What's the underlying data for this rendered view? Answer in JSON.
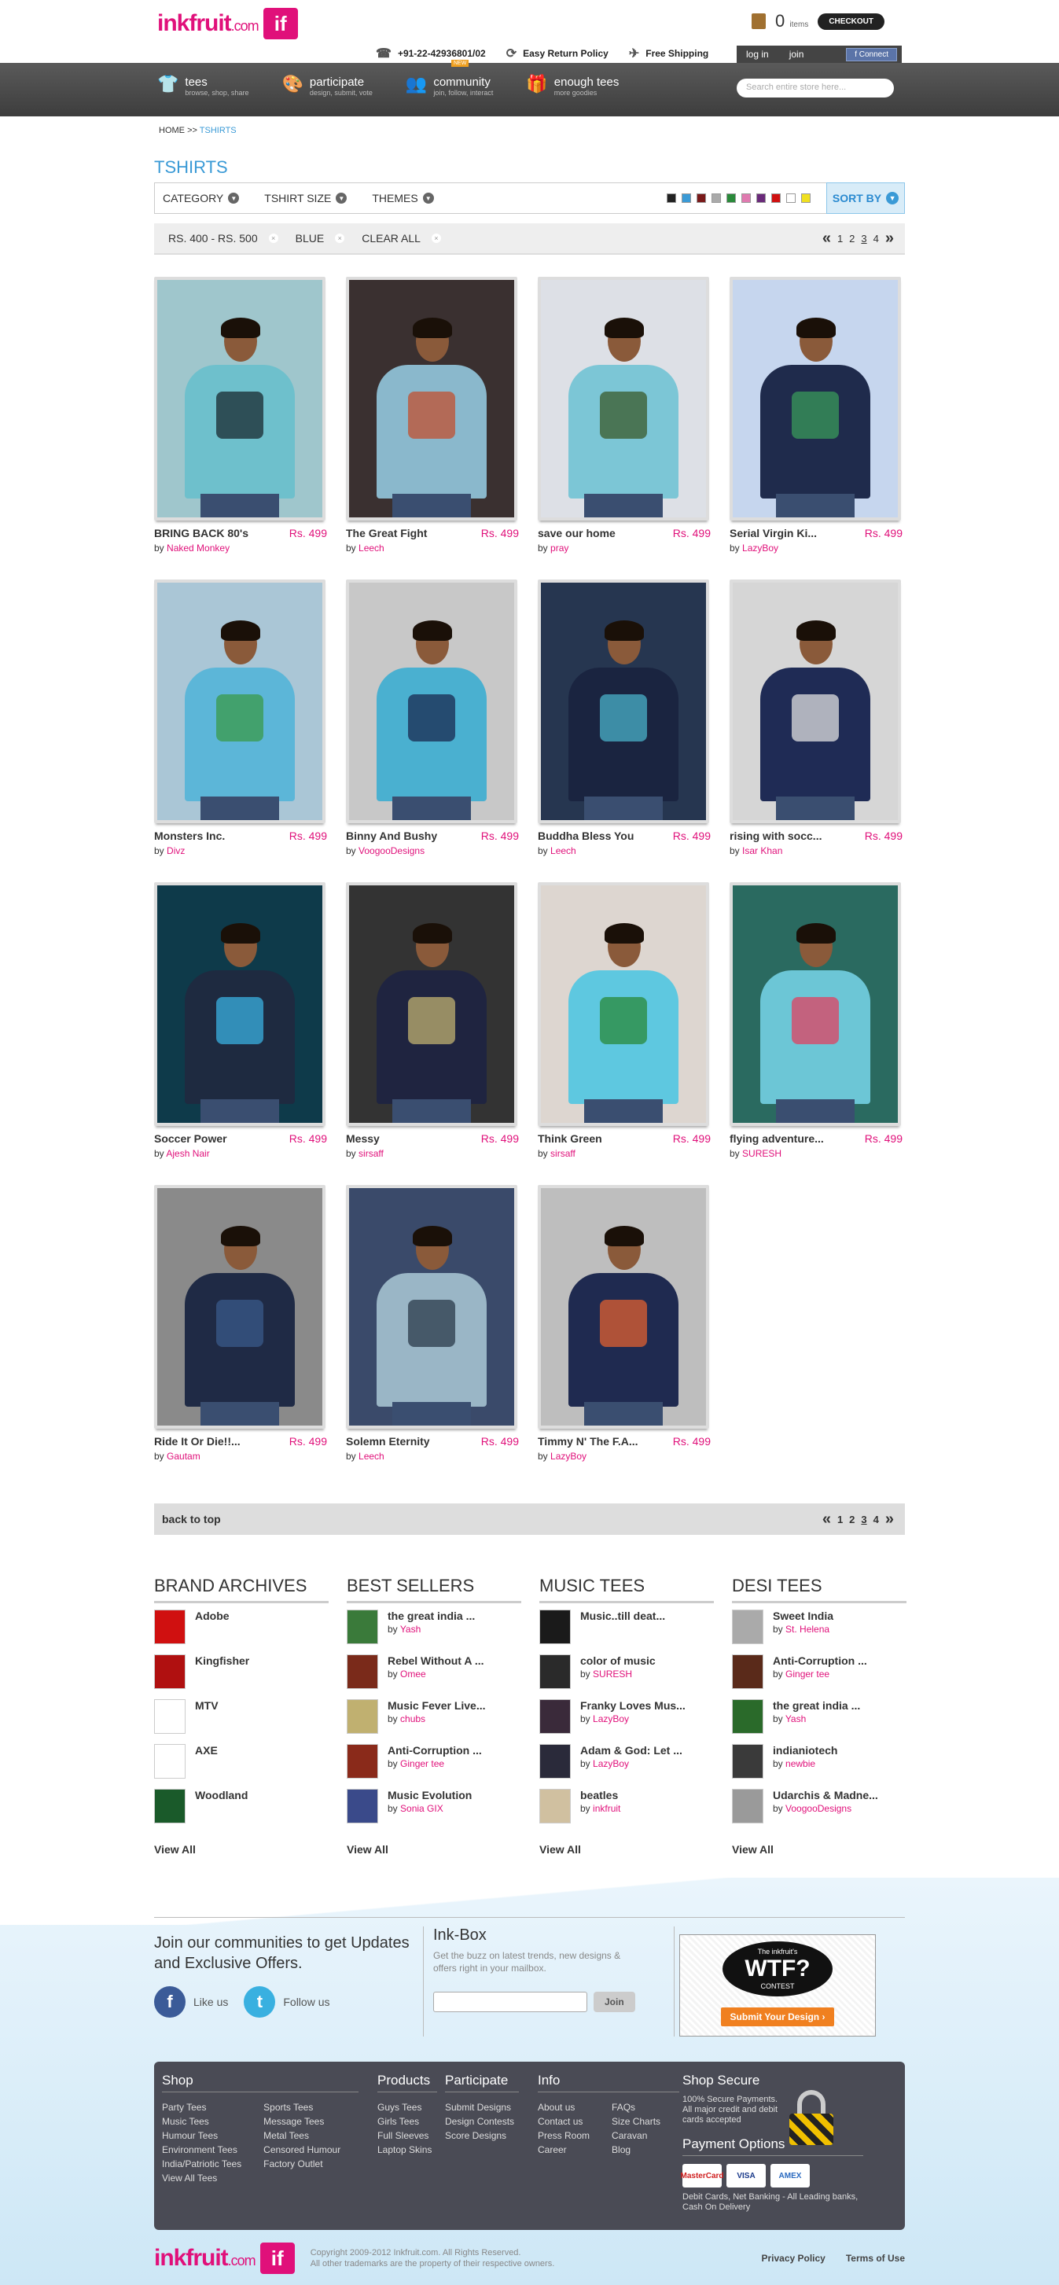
{
  "header": {
    "logo_text": "inkfruit",
    "logo_suffix": ".com",
    "logo_mark": "if",
    "phone": "+91-22-42936801/02",
    "returns": "Easy Return Policy",
    "shipping": "Free Shipping",
    "cart_count": "0",
    "cart_label": "items",
    "checkout_label": "CHECKOUT",
    "login_label": "log in",
    "join_label": "join",
    "fb_connect_label": "Connect"
  },
  "nav": {
    "items": [
      {
        "title": "tees",
        "subtitle": "browse, shop, share",
        "icon": "tshirt-icon"
      },
      {
        "title": "participate",
        "subtitle": "design, submit, vote",
        "icon": "palette-icon"
      },
      {
        "title": "community",
        "subtitle": "join, follow, interact",
        "icon": "people-icon"
      },
      {
        "title": "enough tees",
        "subtitle": "more goodies",
        "icon": "gift-icon"
      }
    ],
    "new_tag": "NEW",
    "search_placeholder": "Search entire store here..."
  },
  "breadcrumb": {
    "home": "HOME",
    "sep": ">>",
    "current": "TSHIRTS"
  },
  "page_title": "TSHIRTS",
  "filters": {
    "category": "CATEGORY",
    "size": "TSHIRT SIZE",
    "themes": "THEMES",
    "swatches": [
      "#222222",
      "#3a9ad6",
      "#7a1a1a",
      "#aaaaaa",
      "#2a8a3a",
      "#e07ab0",
      "#6a2a7a",
      "#d01010",
      "#ffffff",
      "#f0e020"
    ],
    "sort_label": "SORT BY"
  },
  "active_filters": {
    "chips": [
      "RS. 400 - RS. 500",
      "BLUE",
      "CLEAR ALL"
    ],
    "pages": [
      "1",
      "2",
      "3",
      "4"
    ]
  },
  "products": [
    {
      "name": "BRING BACK 80's",
      "price": "Rs. 499",
      "by": "by",
      "artist": "Naked Monkey",
      "bg": "#9fc6cc",
      "tee": "#6ec0cc",
      "art": "#1a2a30"
    },
    {
      "name": "The Great Fight",
      "price": "Rs. 499",
      "by": "by",
      "artist": "Leech",
      "bg": "#3a3030",
      "tee": "#8ab8cc",
      "art": "#c05030"
    },
    {
      "name": "save our home",
      "price": "Rs. 499",
      "by": "by",
      "artist": "pray",
      "bg": "#dde0e6",
      "tee": "#7cc6d6",
      "art": "#3a5a2a"
    },
    {
      "name": "Serial Virgin Ki...",
      "price": "Rs. 499",
      "by": "by",
      "artist": "LazyBoy",
      "bg": "#c6d6ee",
      "tee": "#1f2b4c",
      "art": "#3a9a5a"
    },
    {
      "name": "Monsters Inc.",
      "price": "Rs. 499",
      "by": "by",
      "artist": "Divz",
      "bg": "#aac6d6",
      "tee": "#5cb6d8",
      "art": "#3a9a4a"
    },
    {
      "name": "Binny And Bushy",
      "price": "Rs. 499",
      "by": "by",
      "artist": "VoogooDesigns",
      "bg": "#c8c8c8",
      "tee": "#4ab0d0",
      "art": "#1a2a50"
    },
    {
      "name": "Buddha Bless You",
      "price": "Rs. 499",
      "by": "by",
      "artist": "Leech",
      "bg": "#263650",
      "tee": "#1a2440",
      "art": "#4ab0c8"
    },
    {
      "name": "rising with socc...",
      "price": "Rs. 499",
      "by": "by",
      "artist": "Isar Khan",
      "bg": "#d6d6d6",
      "tee": "#1f2b55",
      "art": "#e0e0e0"
    },
    {
      "name": "Soccer Power",
      "price": "Rs. 499",
      "by": "by",
      "artist": "Ajesh Nair",
      "bg": "#0e3a4a",
      "tee": "#1e2a40",
      "art": "#3ab0e0"
    },
    {
      "name": "Messy",
      "price": "Rs. 499",
      "by": "by",
      "artist": "sirsaff",
      "bg": "#333333",
      "tee": "#1f2440",
      "art": "#c0b070"
    },
    {
      "name": "Think Green",
      "price": "Rs. 499",
      "by": "by",
      "artist": "sirsaff",
      "bg": "#ddd6d0",
      "tee": "#5ec8e0",
      "art": "#2a8a3a"
    },
    {
      "name": "flying adventure...",
      "price": "Rs. 499",
      "by": "by",
      "artist": "SURESH",
      "bg": "#2a6a60",
      "tee": "#6cc6d6",
      "art": "#e04060"
    },
    {
      "name": "Ride It Or Die!!...",
      "price": "Rs. 499",
      "by": "by",
      "artist": "Gautam",
      "bg": "#8a8a8a",
      "tee": "#1f2a45",
      "art": "#3a5a8a"
    },
    {
      "name": "Solemn Eternity",
      "price": "Rs. 499",
      "by": "by",
      "artist": "Leech",
      "bg": "#3a4a6a",
      "tee": "#9ab6c6",
      "art": "#2a3a4a"
    },
    {
      "name": "Timmy N' The F.A...",
      "price": "Rs. 499",
      "by": "by",
      "artist": "LazyBoy",
      "bg": "#bebebe",
      "tee": "#1f2a50",
      "art": "#e06030"
    }
  ],
  "back_to_top": "back to top",
  "lists": [
    {
      "heading": "BRAND ARCHIVES",
      "items": [
        {
          "title": "Adobe",
          "by": "",
          "artist": "",
          "thumb": "#d01010"
        },
        {
          "title": "Kingfisher",
          "by": "",
          "artist": "",
          "thumb": "#b01010"
        },
        {
          "title": "MTV",
          "by": "",
          "artist": "",
          "thumb": "#ffffff"
        },
        {
          "title": "AXE",
          "by": "",
          "artist": "",
          "thumb": "#ffffff"
        },
        {
          "title": "Woodland",
          "by": "",
          "artist": "",
          "thumb": "#1a5a2a"
        }
      ],
      "view_all": "View All"
    },
    {
      "heading": "BEST SELLERS",
      "items": [
        {
          "title": "the great india ...",
          "by": "by",
          "artist": "Yash",
          "thumb": "#3a7a3a"
        },
        {
          "title": "Rebel Without A ...",
          "by": "by",
          "artist": "Omee",
          "thumb": "#7a2a1a"
        },
        {
          "title": "Music Fever Live...",
          "by": "by",
          "artist": "chubs",
          "thumb": "#c0b070"
        },
        {
          "title": "Anti-Corruption ...",
          "by": "by",
          "artist": "Ginger tee",
          "thumb": "#8a2a1a"
        },
        {
          "title": "Music Evolution",
          "by": "by",
          "artist": "Sonia GIX",
          "thumb": "#3a4a8a"
        }
      ],
      "view_all": "View All"
    },
    {
      "heading": "MUSIC TEES",
      "items": [
        {
          "title": "Music..till deat...",
          "by": "",
          "artist": "",
          "thumb": "#1a1a1a"
        },
        {
          "title": "color of music",
          "by": "by",
          "artist": "SURESH",
          "thumb": "#2a2a2a"
        },
        {
          "title": "Franky Loves Mus...",
          "by": "by",
          "artist": "LazyBoy",
          "thumb": "#3a2a3a"
        },
        {
          "title": "Adam & God: Let ...",
          "by": "by",
          "artist": "LazyBoy",
          "thumb": "#2a2a3a"
        },
        {
          "title": "beatles",
          "by": "by",
          "artist": "inkfruit",
          "thumb": "#d0c0a0"
        }
      ],
      "view_all": "View All"
    },
    {
      "heading": "DESI TEES",
      "items": [
        {
          "title": "Sweet India",
          "by": "by",
          "artist": "St. Helena",
          "thumb": "#aaaaaa"
        },
        {
          "title": "Anti-Corruption ...",
          "by": "by",
          "artist": "Ginger tee",
          "thumb": "#5a2a1a"
        },
        {
          "title": "the great india ...",
          "by": "by",
          "artist": "Yash",
          "thumb": "#2a6a2a"
        },
        {
          "title": "indianiotech",
          "by": "by",
          "artist": "newbie",
          "thumb": "#3a3a3a"
        },
        {
          "title": "Udarchis & Madne...",
          "by": "by",
          "artist": "VoogooDesigns",
          "thumb": "#9a9a9a"
        }
      ],
      "view_all": "View All"
    }
  ],
  "footer": {
    "join_text": "Join our communities to get Updates and Exclusive Offers.",
    "like_label": "Like us",
    "follow_label": "Follow us",
    "inkbox_title": "Ink-Box",
    "inkbox_desc": "Get the buzz on latest trends, new designs & offers right in your mailbox.",
    "join_button": "Join",
    "wtf_top": "The inkfruit's",
    "wtf_big": "WTF?",
    "wtf_contest": "CONTEST",
    "wtf_submit": "Submit Your Design",
    "shop_title": "Shop",
    "shop_col1": [
      "Party Tees",
      "Music Tees",
      "Humour Tees",
      "Environment Tees",
      "India/Patriotic Tees",
      "View All Tees"
    ],
    "shop_col2": [
      "Sports Tees",
      "Message Tees",
      "Metal Tees",
      "Censored Humour",
      "Factory Outlet"
    ],
    "products_title": "Products",
    "products_links": [
      "Guys Tees",
      "Girls Tees",
      "Full Sleeves",
      "Laptop Skins"
    ],
    "participate_title": "Participate",
    "participate_links": [
      "Submit Designs",
      "Design Contests",
      "Score Designs"
    ],
    "info_title": "Info",
    "info_col1": [
      "About us",
      "Contact us",
      "Press Room",
      "Career"
    ],
    "info_col2": [
      "FAQs",
      "Size Charts",
      "Caravan",
      "Blog"
    ],
    "secure_title": "Shop Secure",
    "secure_text": "100% Secure Payments. All major credit and debit cards accepted",
    "payment_title": "Payment Options",
    "payment_logos": [
      "MasterCard",
      "VISA",
      "AMEX"
    ],
    "payment_text": "Debit Cards, Net Banking - All Leading banks, Cash On Delivery",
    "copyright": "Copyright 2009-2012 Inkfruit.com. All Rights Reserved.",
    "trademark": "All other trademarks are the property of their respective owners.",
    "privacy": "Privacy Policy",
    "terms": "Terms of Use"
  }
}
